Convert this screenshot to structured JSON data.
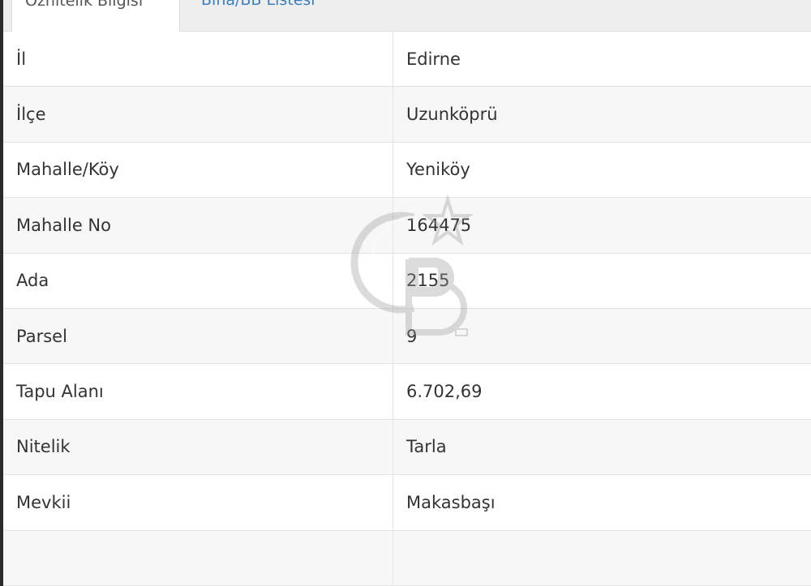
{
  "tabs": [
    {
      "label": "Öznitelik Bilgisi",
      "active": true
    },
    {
      "label": "Bina/BB Listesi",
      "active": false
    }
  ],
  "rows": [
    {
      "key": "İl",
      "value": "Edirne"
    },
    {
      "key": "İlçe",
      "value": "Uzunköprü"
    },
    {
      "key": "Mahalle/Köy",
      "value": "Yeniköy"
    },
    {
      "key": "Mahalle No",
      "value": "164475"
    },
    {
      "key": "Ada",
      "value": "2155"
    },
    {
      "key": "Parsel",
      "value": "9"
    },
    {
      "key": "Tapu Alanı",
      "value": "6.702,69"
    },
    {
      "key": "Nitelik",
      "value": "Tarla"
    },
    {
      "key": "Mevkii",
      "value": "Makasbaşı"
    }
  ],
  "watermark": {
    "icon": "cb-logo-watermark"
  }
}
